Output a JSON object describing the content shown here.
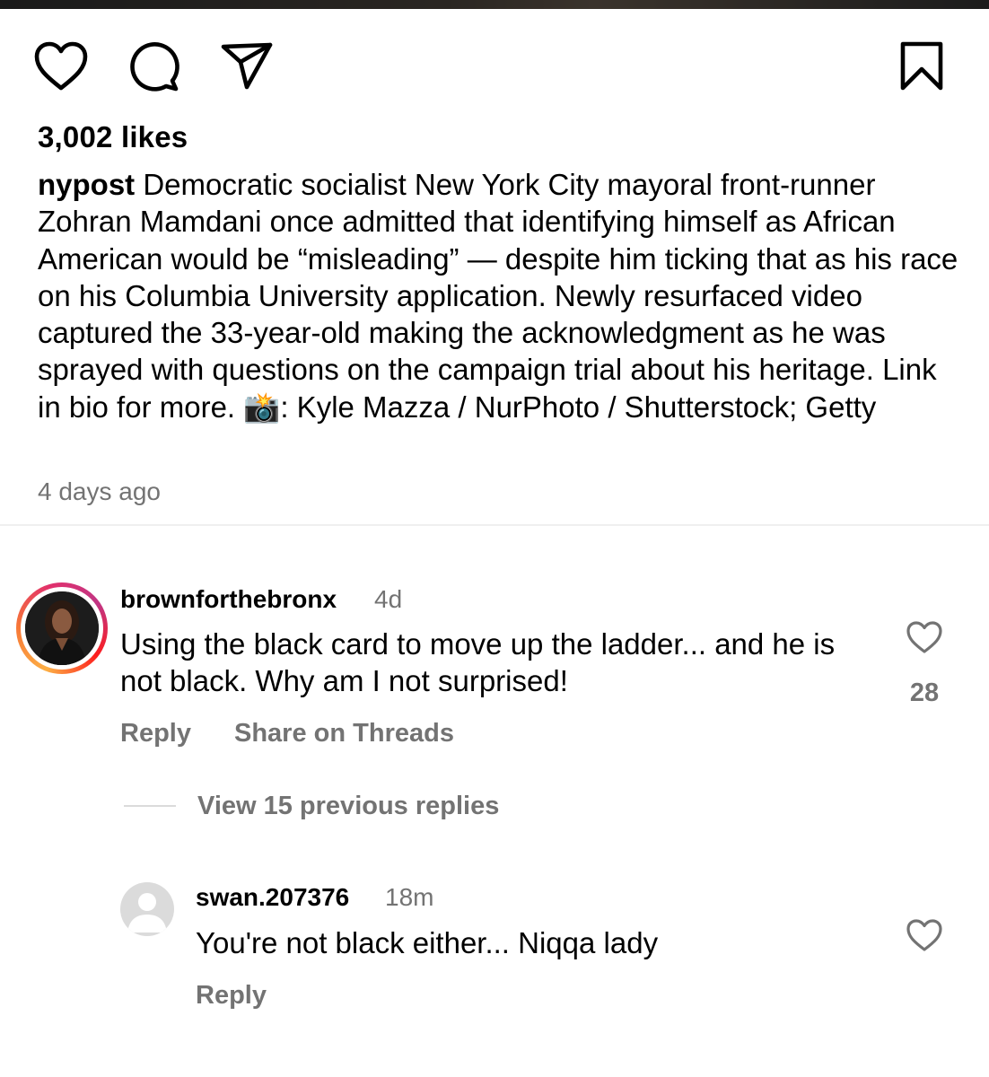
{
  "post": {
    "likes": "3,002 likes",
    "username": "nypost",
    "caption": " Democratic socialist New York City mayoral front-runner Zohran Mamdani once admitted that identifying himself as African American would be “misleading” — despite him ticking that as his race on his Columbia University application. Newly resurfaced video captured the 33-year-old making the acknowledgment as he was sprayed with questions on the campaign trial about his heritage. Link in bio for more. 📸: Kyle Mazza / NurPhoto / Shutterstock; Getty",
    "time": "4 days ago",
    "icons": [
      "heart-icon",
      "comment-icon",
      "share-icon",
      "bookmark-icon"
    ]
  },
  "comments": [
    {
      "username": "brownforthebronx",
      "time": "4d",
      "text": "Using the black card to move up the ladder... and he is not black. Why am I not surprised!",
      "likes": "28",
      "reply_label": "Reply",
      "share_label": "Share on Threads",
      "view_replies_label": "View 15 previous replies"
    },
    {
      "username": "swan.207376",
      "time": "18m",
      "text": "You're not black either... Niqqa lady",
      "reply_label": "Reply"
    }
  ],
  "colors": {
    "primary_text": "#000000",
    "secondary_text": "#737373",
    "divider": "#efefef",
    "story_ring": [
      "#fcaf45",
      "#e1306c",
      "#c13584"
    ]
  }
}
